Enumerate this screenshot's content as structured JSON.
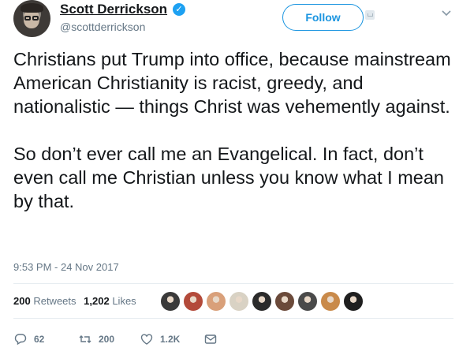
{
  "author": {
    "name": "Scott Derrickson",
    "handle": "@scottderrickson",
    "verified": true
  },
  "header": {
    "follow_label": "Follow"
  },
  "tweet": {
    "paragraphs": [
      "Christians put Trump into office, because mainstream American Christianity is racist, greedy, and nationalistic — things Christ was vehemently against.",
      "So don’t ever call me an Evangelical. In fact, don’t even call me Christian unless you know what I mean by that."
    ],
    "timestamp": "9:53 PM - 24 Nov 2017"
  },
  "stats": {
    "retweets_count": "200",
    "retweets_label": "Retweets",
    "likes_count": "1,202",
    "likes_label": "Likes"
  },
  "likers": [
    {
      "color": "#3a3a3a"
    },
    {
      "color": "#b34a3a"
    },
    {
      "color": "#d9a07a"
    },
    {
      "color": "#d9d2c4"
    },
    {
      "color": "#2b2b2b"
    },
    {
      "color": "#6b4a3a"
    },
    {
      "color": "#4a4a4a"
    },
    {
      "color": "#c98a4a"
    },
    {
      "color": "#1f1f1f"
    }
  ],
  "actions": {
    "reply_count": "62",
    "retweet_count": "200",
    "like_count": "1.2K"
  },
  "colors": {
    "accent": "#1da1f2",
    "follow": "#1b95e0",
    "muted": "#657786"
  }
}
